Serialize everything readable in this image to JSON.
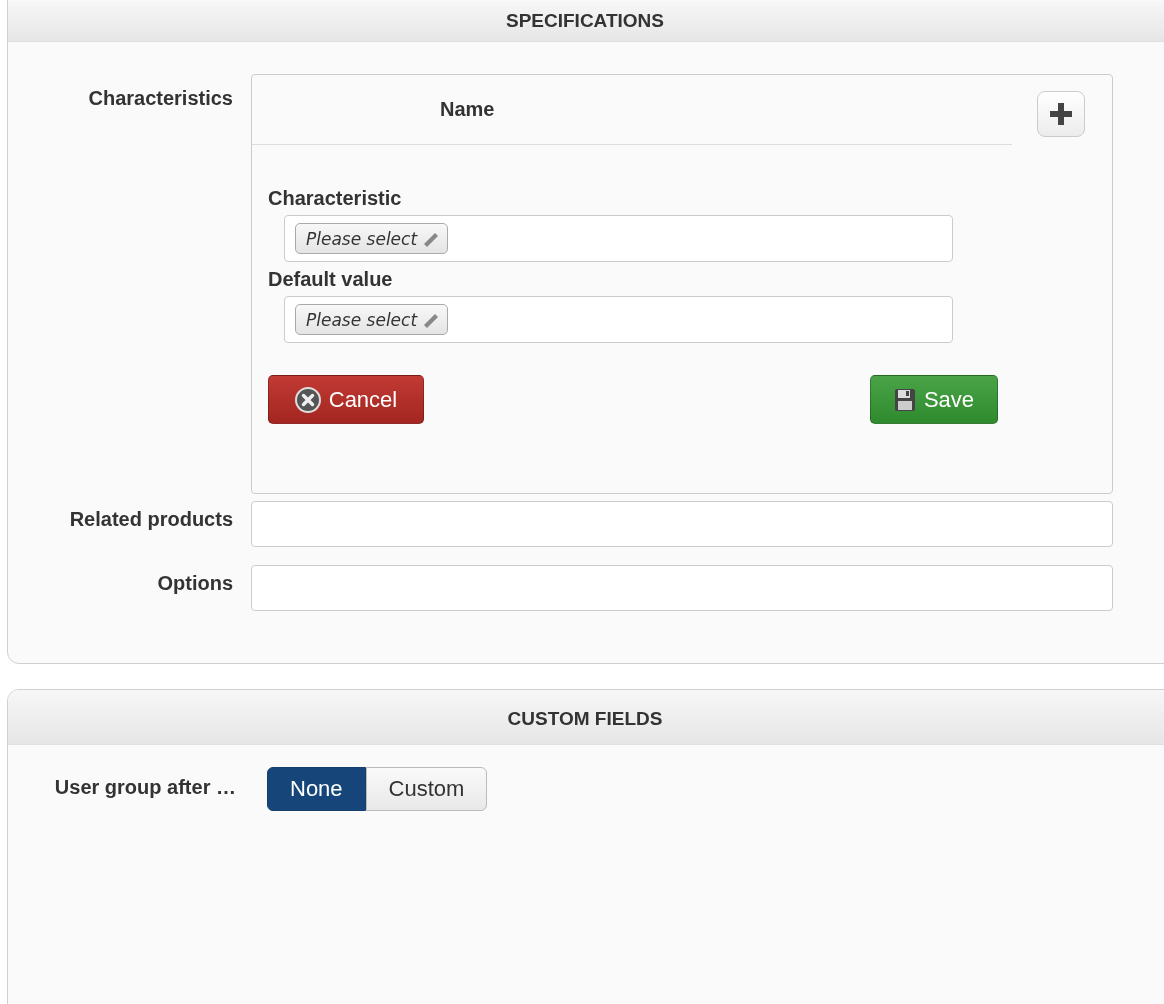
{
  "specifications": {
    "title": "SPECIFICATIONS",
    "characteristics": {
      "label": "Characteristics",
      "column": "Name",
      "fields": [
        {
          "label": "Characteristic",
          "placeholder": "Please select"
        },
        {
          "label": "Default value",
          "placeholder": "Please select"
        }
      ],
      "buttons": [
        {
          "kind": "cancel",
          "label": "Cancel"
        },
        {
          "kind": "save",
          "label": "Save"
        }
      ]
    },
    "rows": [
      {
        "label": "Related products"
      },
      {
        "label": "Options"
      }
    ]
  },
  "custom_fields": {
    "title": "CUSTOM FIELDS",
    "label": "User group after …",
    "options": [
      {
        "label": "None",
        "selected": true
      },
      {
        "label": "Custom",
        "selected": false
      }
    ]
  }
}
